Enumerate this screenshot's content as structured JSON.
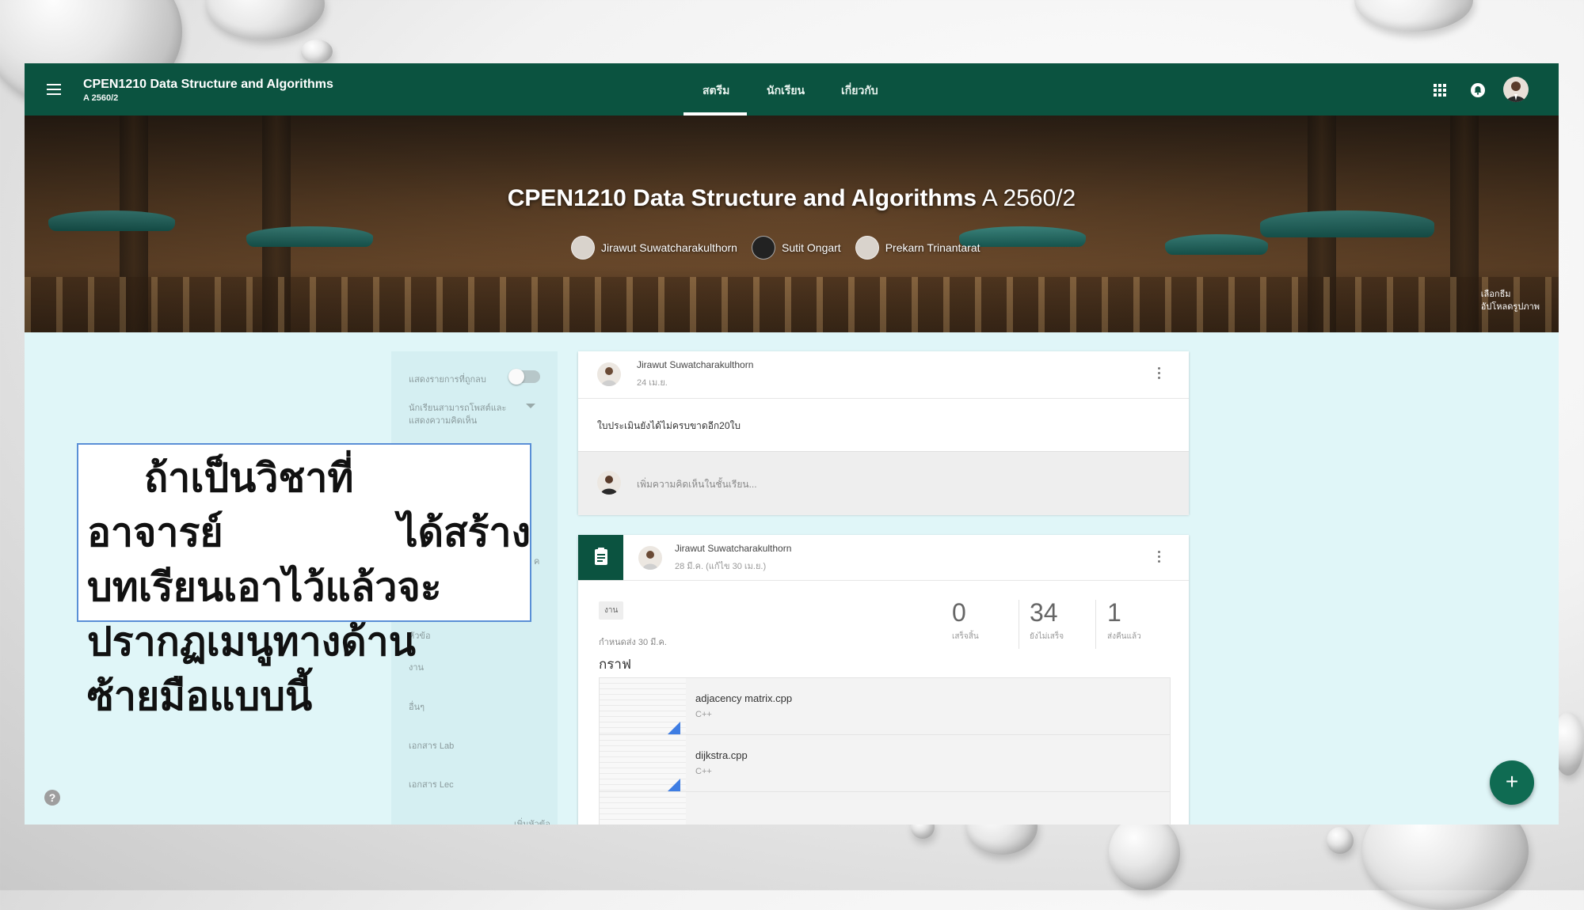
{
  "header": {
    "course_title": "CPEN1210 Data Structure and Algorithms",
    "course_section": "A 2560/2",
    "tabs": [
      {
        "label": "สตรีม"
      },
      {
        "label": "นักเรียน"
      },
      {
        "label": "เกี่ยวกับ"
      }
    ],
    "active_tab": "สตรีม"
  },
  "banner": {
    "title_bold": "CPEN1210 Data Structure and Algorithms",
    "title_section": "A 2560/2",
    "teachers": [
      {
        "name": "Jirawut Suwatcharakulthorn"
      },
      {
        "name": "Sutit Ongart"
      },
      {
        "name": "Prekarn Trinantarat"
      }
    ],
    "choose_theme": "เลือกธีม",
    "upload_photo": "อัปโหลดรูปภาพ"
  },
  "topic_panel": {
    "show_deleted": "แสดงรายการที่ถูกลบ",
    "student_permission_line1": "นักเรียนสามารถโพสต์และ",
    "student_permission_line2": "แสดงความคิดเห็น",
    "topics": [
      {
        "label": "หัวข้อ"
      },
      {
        "label": "งาน"
      },
      {
        "label": "อื่นๆ"
      },
      {
        "label": "เอกสาร Lab"
      },
      {
        "label": "เอกสาร Lec"
      }
    ],
    "partial_letter": "ค",
    "add_topic": "เพิ่มหัวข้อ"
  },
  "posts": [
    {
      "author": "Jirawut Suwatcharakulthorn",
      "date": "24 เม.ย.",
      "text": "ใบประเมินยังได้ไม่ครบขาดอีก20ใบ",
      "comment_placeholder": "เพิ่มความคิดเห็นในชั้นเรียน..."
    },
    {
      "author": "Jirawut Suwatcharakulthorn",
      "date": "28 มี.ค. (แก้ไข 30 เม.ย.)",
      "chip": "งาน",
      "due": "กำหนดส่ง 30 มี.ค.",
      "title": "กราฟ",
      "stats": [
        {
          "value": "0",
          "label": "เสร็จสิ้น"
        },
        {
          "value": "34",
          "label": "ยังไม่เสร็จ"
        },
        {
          "value": "1",
          "label": "ส่งคืนแล้ว"
        }
      ],
      "files": [
        {
          "name": "adjacency matrix.cpp",
          "type": "C++"
        },
        {
          "name": "dijkstra.cpp",
          "type": "C++"
        }
      ]
    }
  ],
  "overlay": {
    "line1": "ถ้าเป็นวิชาที่",
    "line2a": "อาจารย์",
    "line2b": "ได้สร้าง",
    "line3": "บทเรียนเอาไว้แล้วจะ",
    "line4": "ปรากฏเมนูทางด้าน",
    "line5": "ซ้ายมือแบบนี้"
  },
  "icons": {
    "menu": "menu-icon",
    "apps": "apps-grid-icon",
    "notifications": "bell-icon",
    "help": "help-icon",
    "assignment": "assignment-icon",
    "add": "plus-icon",
    "more": "more-vert-icon"
  },
  "fab_label": "+",
  "help_label": "?",
  "colors": {
    "header": "#0b5340",
    "page_bg": "#e0f6f8",
    "file_corner": "#3e7de3",
    "overlay_border": "#5a8fd6"
  }
}
